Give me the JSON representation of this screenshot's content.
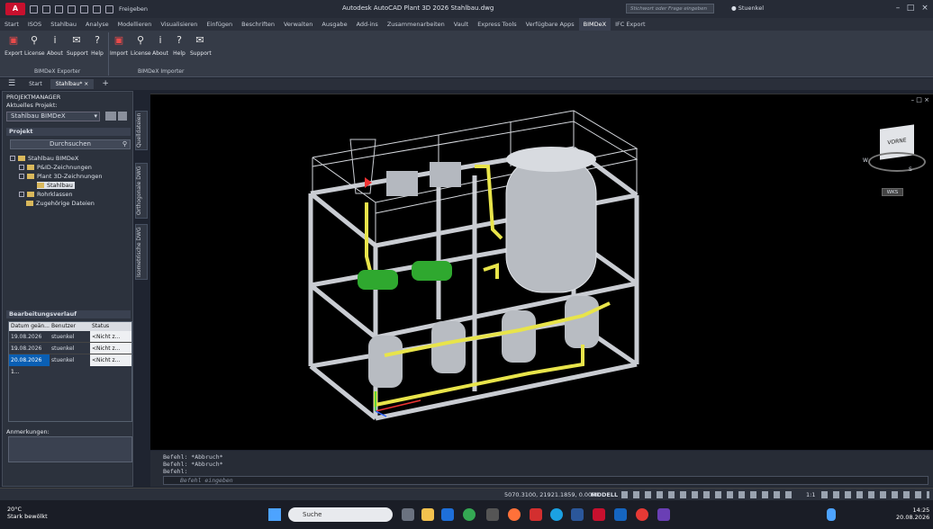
{
  "window": {
    "app_button": "A",
    "share_label": "Freigeben",
    "title": "Autodesk AutoCAD Plant 3D 2026   Stahlbau.dwg",
    "search_placeholder": "Stichwort oder Frage eingeben",
    "user": "Stuenkel"
  },
  "ribbon_tabs": [
    "Start",
    "ISOS",
    "Stahlbau",
    "Analyse",
    "Modellieren",
    "Visualisieren",
    "Einfügen",
    "Beschriften",
    "Verwalten",
    "Ausgabe",
    "Add-ins",
    "Zusammenarbeiten",
    "Vault",
    "Express Tools",
    "Verfügbare Apps",
    "BIMDeX",
    "IFC Export"
  ],
  "ribbon_active_tab": "BIMDeX",
  "ribbon": {
    "exporter_buttons": [
      "Export",
      "License",
      "About",
      "Support",
      "Help"
    ],
    "exporter_group": "BIMDeX Exporter",
    "importer_buttons": [
      "Import",
      "License",
      "About",
      "Help",
      "Support"
    ],
    "importer_group": "BIMDeX Importer"
  },
  "file_tabs": [
    "Start",
    "Stahlbau*"
  ],
  "project_manager": {
    "title": "PROJEKTMANAGER",
    "current_project_label": "Aktuelles Projekt:",
    "current_project": "Stahlbau BIMDeX",
    "project_section": "Projekt",
    "search_label": "Durchsuchen",
    "tree": [
      "Stahlbau BIMDeX",
      "P&ID-Zeichnungen",
      "Plant 3D-Zeichnungen",
      "Stahlbau",
      "Rohrklassen",
      "Zugehörige Dateien"
    ],
    "history_section": "Bearbeitungsverlauf",
    "history_columns": [
      "Datum geän...",
      "Benutzer",
      "Status"
    ],
    "history_rows": [
      {
        "date": "19.08.2026 1...",
        "user": "stuenkel",
        "status": "<Nicht z..."
      },
      {
        "date": "19.08.2026 1...",
        "user": "stuenkel",
        "status": "<Nicht z..."
      },
      {
        "date": "20.08.2026 1...",
        "user": "stuenkel",
        "status": "<Nicht z..."
      }
    ],
    "notes_label": "Anmerkungen:"
  },
  "side_tabs": [
    "Quelldateien",
    "Orthogonale DWG",
    "Isometrische DWG"
  ],
  "viewcube": {
    "face": "VORNE",
    "compass_n": "N",
    "compass_s": "S",
    "compass_o": "O",
    "compass_w": "W",
    "wks": "WKS"
  },
  "command_lines": [
    "Befehl: *Abbruch*",
    "Befehl: *Abbruch*",
    "Befehl:"
  ],
  "command_prompt": "Befehl eingeben",
  "status": {
    "coords": "5070.3100, 21921.1859, 0.0000",
    "mode": "MODELL",
    "scale": "1:1"
  },
  "taskbar": {
    "weather_temp": "20°C",
    "weather_text": "Stark bewölkt",
    "search": "Suche",
    "time": "14:25",
    "date": "20.08.2026"
  },
  "colors": {
    "accent": "#c8102e",
    "pipe": "#e8e44a",
    "pump": "#2fa82f",
    "steel": "#c9ccd2",
    "selection": "#0a5fb4"
  }
}
